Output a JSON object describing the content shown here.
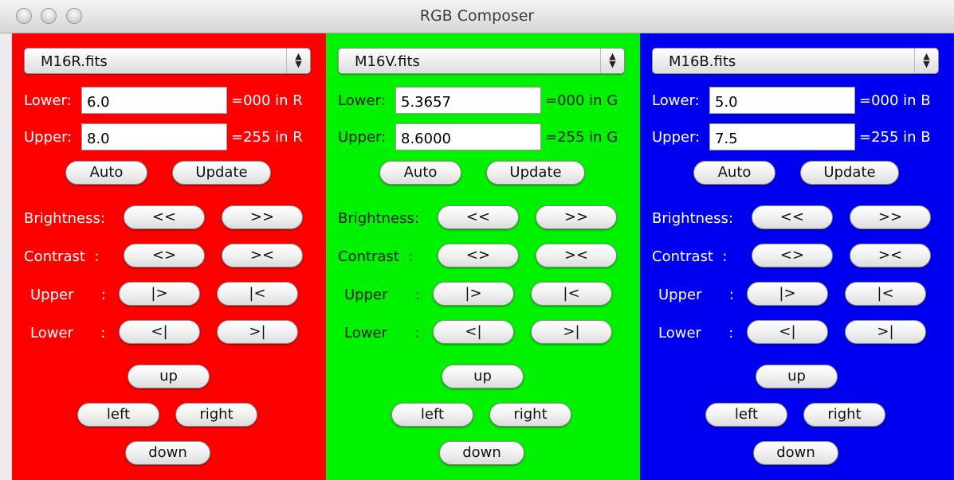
{
  "window": {
    "title": "RGB Composer"
  },
  "labels": {
    "lower": "Lower:",
    "upper": "Upper:",
    "brightness": "Brightness:",
    "contrast": "Contrast  :",
    "upper_row": "Upper      :",
    "lower_row": "Lower      :"
  },
  "buttons": {
    "auto": "Auto",
    "update": "Update",
    "bright_down": "<<",
    "bright_up": ">>",
    "contrast_up": "<>",
    "contrast_down": "><",
    "upper_right": "|>",
    "upper_left": "|<",
    "lower_left": "<|",
    "lower_right": ">|",
    "up": "up",
    "left": "left",
    "right": "right",
    "down": "down"
  },
  "panels": [
    {
      "channel": "red",
      "color": "#ff0000",
      "file": "M16R.fits",
      "lower": "6.0",
      "upper": "8.0",
      "lower_unit": "=000 in R",
      "upper_unit": "=255 in R"
    },
    {
      "channel": "green",
      "color": "#00f200",
      "file": "M16V.fits",
      "lower": "5.3657",
      "upper": "8.6000",
      "lower_unit": "=000 in G",
      "upper_unit": "=255 in G"
    },
    {
      "channel": "blue",
      "color": "#0000f0",
      "file": "M16B.fits",
      "lower": "5.0",
      "upper": "7.5",
      "lower_unit": "=000 in B",
      "upper_unit": "=255 in B"
    }
  ]
}
